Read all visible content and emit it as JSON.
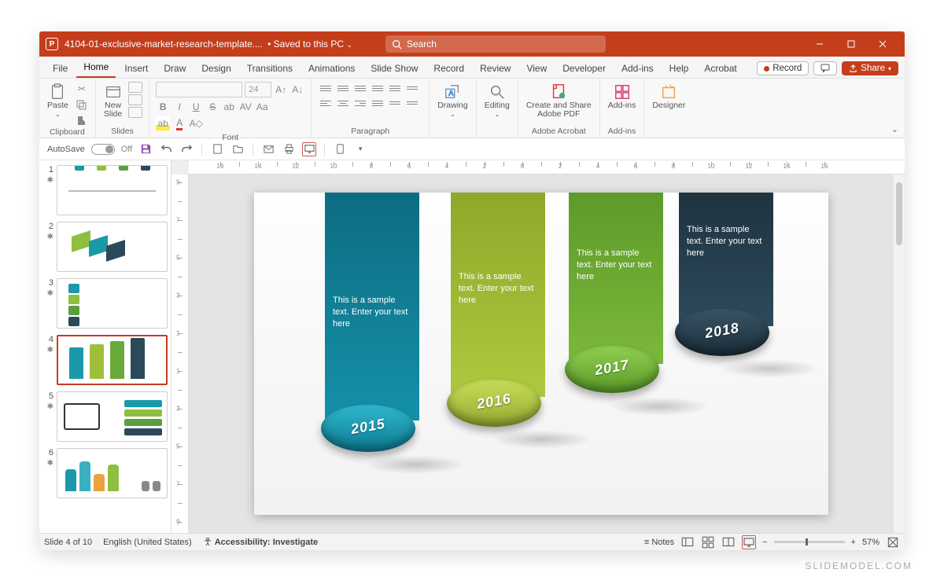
{
  "titlebar": {
    "filename": "4104-01-exclusive-market-research-template....",
    "save_status": "Saved to this PC",
    "search_placeholder": "Search"
  },
  "tabs": [
    "File",
    "Home",
    "Insert",
    "Draw",
    "Design",
    "Transitions",
    "Animations",
    "Slide Show",
    "Record",
    "Review",
    "View",
    "Developer",
    "Add-ins",
    "Help",
    "Acrobat"
  ],
  "active_tab": "Home",
  "title_actions": {
    "record": "Record",
    "share": "Share"
  },
  "ribbon": {
    "clipboard": {
      "paste": "Paste",
      "label": "Clipboard"
    },
    "slides": {
      "new_slide": "New\nSlide",
      "label": "Slides"
    },
    "font": {
      "label": "Font",
      "size": "24"
    },
    "paragraph": {
      "label": "Paragraph"
    },
    "drawing": {
      "label": "Drawing"
    },
    "editing": {
      "label": "Editing"
    },
    "acrobat": {
      "btn": "Create and Share\nAdobe PDF",
      "label": "Adobe Acrobat"
    },
    "addins": {
      "btn": "Add-ins",
      "label": "Add-ins"
    },
    "designer": {
      "btn": "Designer"
    }
  },
  "qat": {
    "autosave": "AutoSave",
    "off": "Off"
  },
  "thumbs": [
    1,
    2,
    3,
    4,
    5,
    6
  ],
  "selected_thumb": 4,
  "slide": {
    "sample": "This is a sample text. Enter your text here",
    "years": [
      "2015",
      "2016",
      "2017",
      "2018"
    ]
  },
  "statusbar": {
    "slide": "Slide 4 of 10",
    "lang": "English (United States)",
    "access": "Accessibility: Investigate",
    "notes": "Notes",
    "zoom": "57%"
  },
  "watermark": "SLIDEMODEL.COM"
}
